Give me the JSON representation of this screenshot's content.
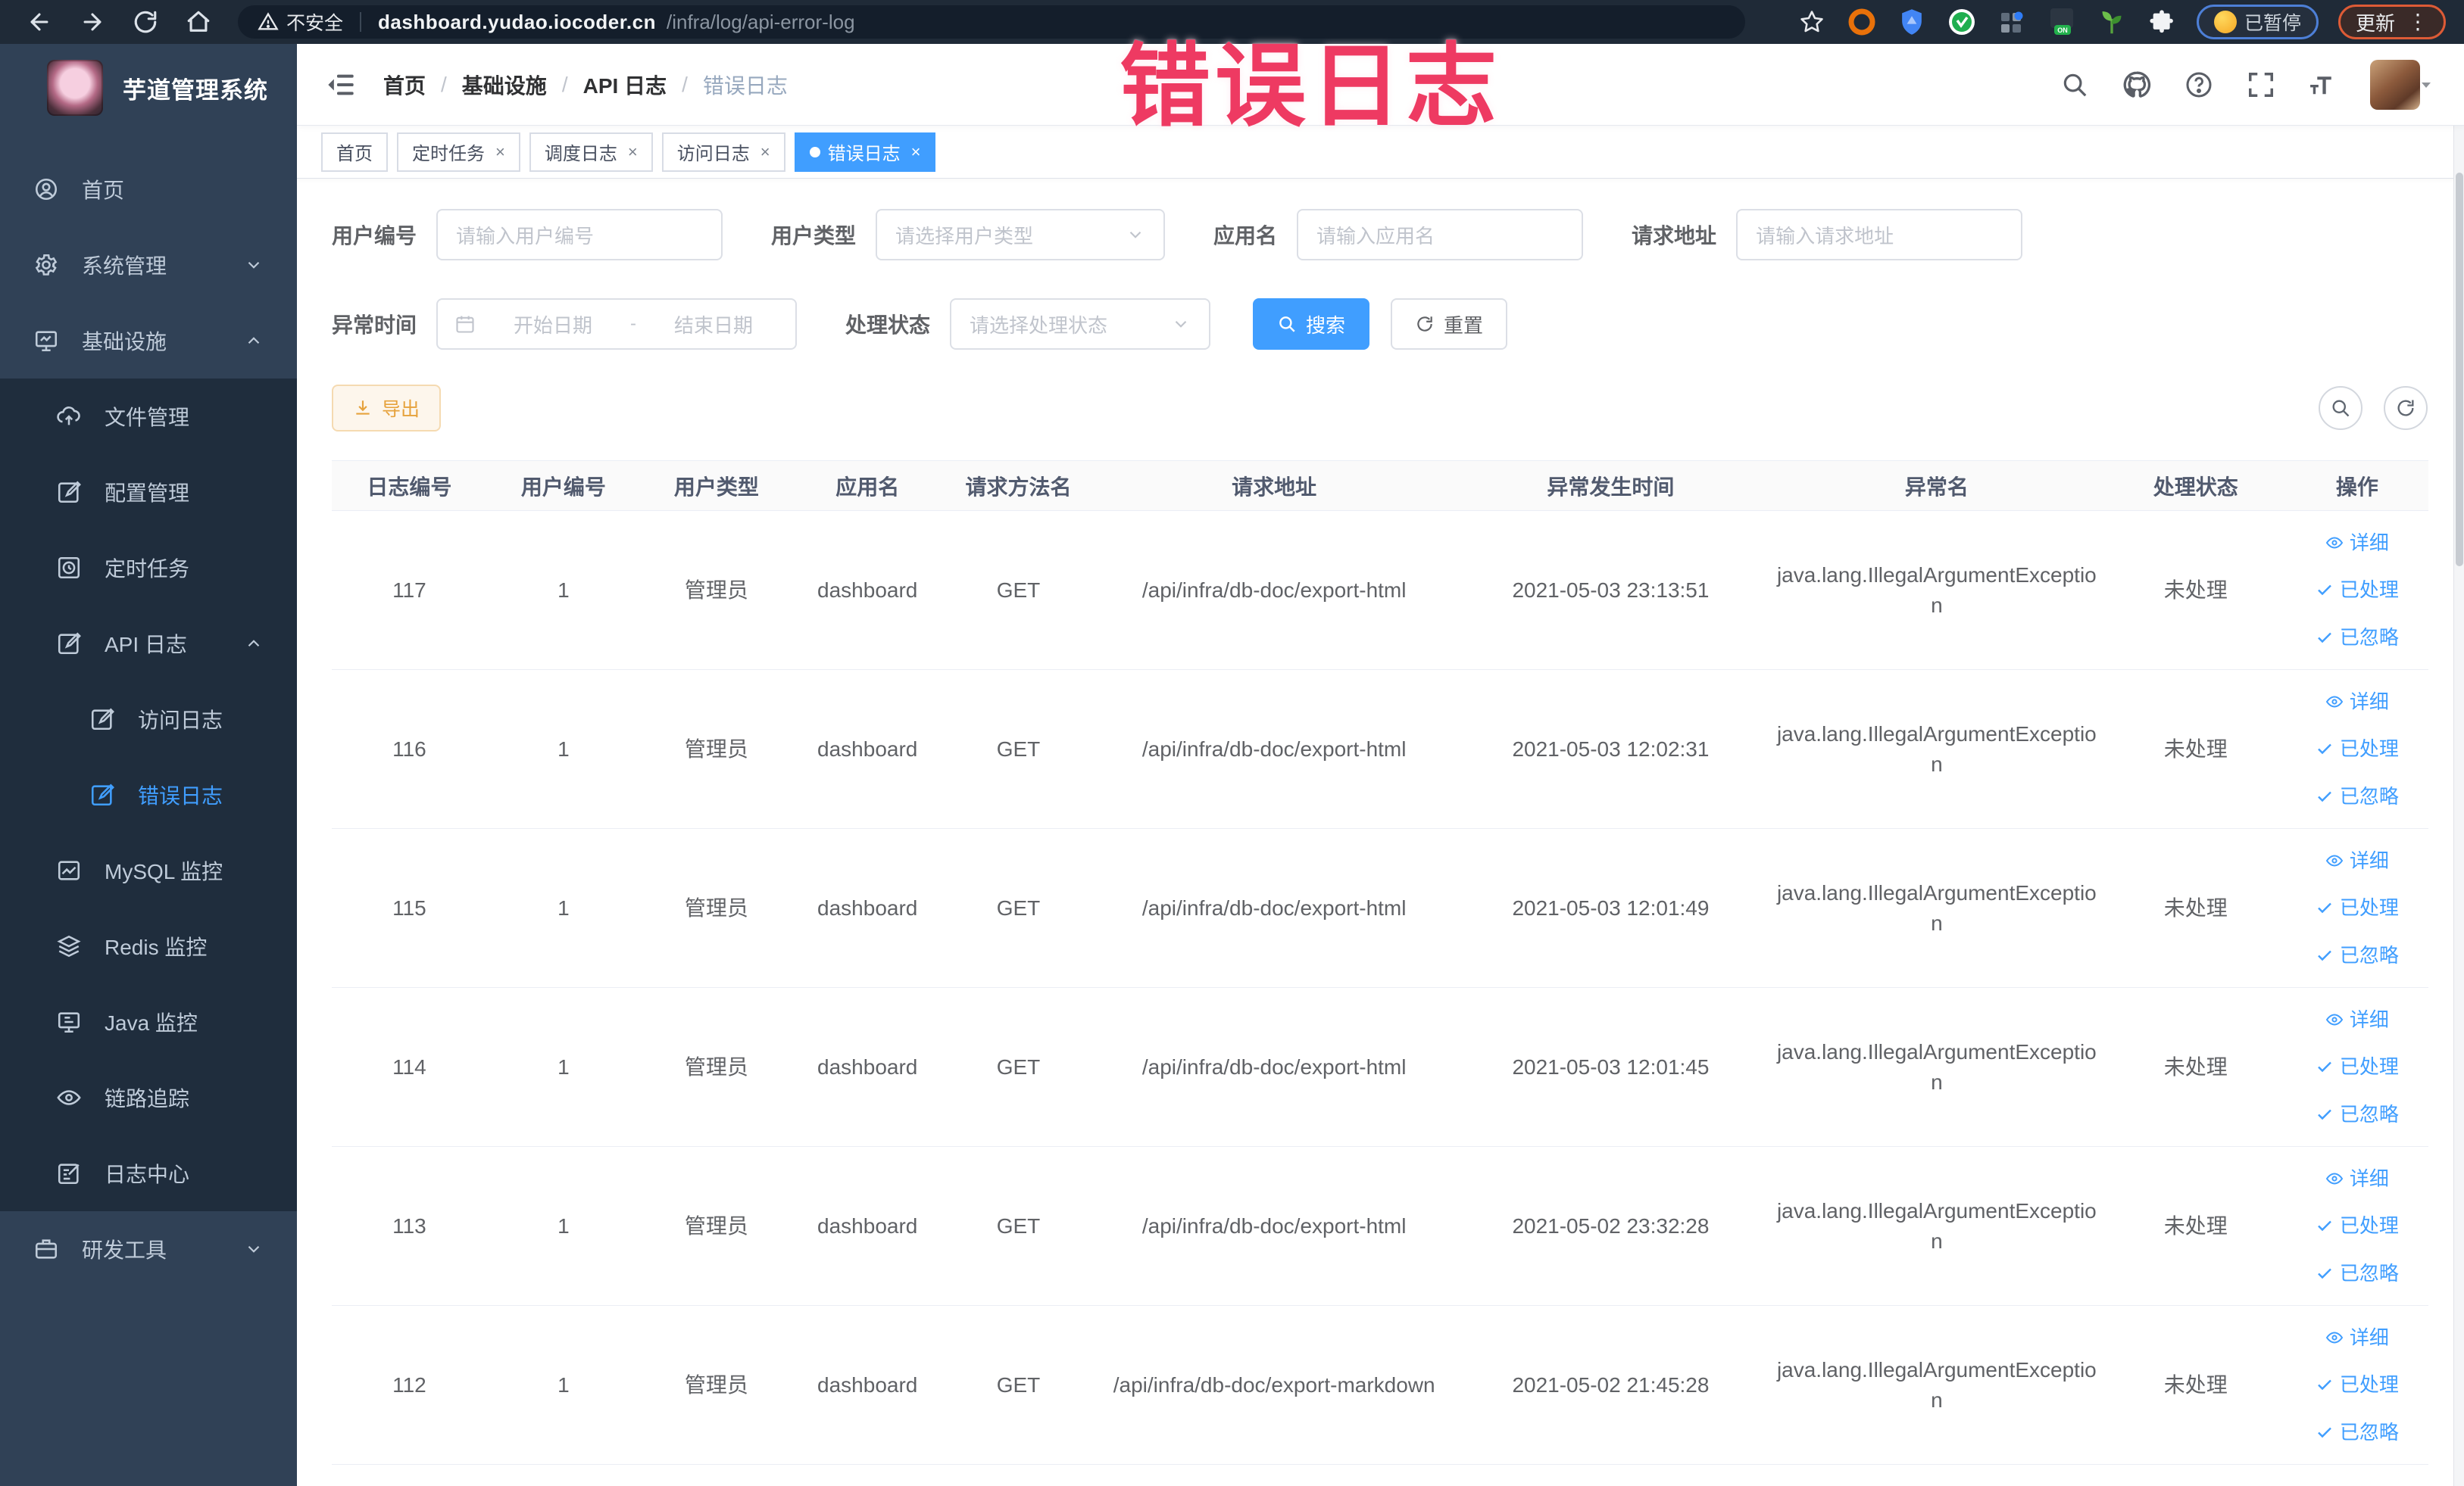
{
  "browser": {
    "security_label": "不安全",
    "url_domain": "dashboard.yudao.iocoder.cn",
    "url_path": "/infra/log/api-error-log",
    "paused_label": "已暂停",
    "update_label": "更新",
    "menu_dots": "⋮"
  },
  "annotation": {
    "text": "错误日志"
  },
  "sidebar": {
    "title": "芋道管理系统",
    "items": {
      "home": "首页",
      "system": "系统管理",
      "infra": "基础设施",
      "file": "文件管理",
      "config": "配置管理",
      "job": "定时任务",
      "api_log": "API 日志",
      "access_log": "访问日志",
      "error_log": "错误日志",
      "mysql": "MySQL 监控",
      "redis": "Redis 监控",
      "java": "Java 监控",
      "trace": "链路追踪",
      "log_center": "日志中心",
      "dev_tool": "研发工具"
    }
  },
  "header": {
    "breadcrumb": [
      "首页",
      "基础设施",
      "API 日志",
      "错误日志"
    ],
    "separator": "/"
  },
  "tabs": [
    {
      "label": "首页"
    },
    {
      "label": "定时任务"
    },
    {
      "label": "调度日志"
    },
    {
      "label": "访问日志"
    },
    {
      "label": "错误日志"
    }
  ],
  "close_glyph": "×",
  "filters": {
    "user_id": {
      "label": "用户编号",
      "placeholder": "请输入用户编号"
    },
    "user_type": {
      "label": "用户类型",
      "placeholder": "请选择用户类型"
    },
    "app_name": {
      "label": "应用名",
      "placeholder": "请输入应用名"
    },
    "req_url": {
      "label": "请求地址",
      "placeholder": "请输入请求地址"
    },
    "ex_time": {
      "label": "异常时间",
      "start_placeholder": "开始日期",
      "range_separator": "-",
      "end_placeholder": "结束日期"
    },
    "status": {
      "label": "处理状态",
      "placeholder": "请选择处理状态"
    },
    "search_label": "搜索",
    "reset_label": "重置"
  },
  "toolbar": {
    "export_label": "导出"
  },
  "table": {
    "headers": [
      "日志编号",
      "用户编号",
      "用户类型",
      "应用名",
      "请求方法名",
      "请求地址",
      "异常发生时间",
      "异常名",
      "处理状态",
      "操作"
    ],
    "actions": {
      "detail": "详细",
      "processed": "已处理",
      "ignored": "已忽略"
    },
    "rows": [
      {
        "id": "117",
        "user_id": "1",
        "user_type": "管理员",
        "app": "dashboard",
        "method": "GET",
        "url": "/api/infra/db-doc/export-html",
        "time": "2021-05-03 23:13:51",
        "exception": "java.lang.IllegalArgumentException",
        "status": "未处理"
      },
      {
        "id": "116",
        "user_id": "1",
        "user_type": "管理员",
        "app": "dashboard",
        "method": "GET",
        "url": "/api/infra/db-doc/export-html",
        "time": "2021-05-03 12:02:31",
        "exception": "java.lang.IllegalArgumentException",
        "status": "未处理"
      },
      {
        "id": "115",
        "user_id": "1",
        "user_type": "管理员",
        "app": "dashboard",
        "method": "GET",
        "url": "/api/infra/db-doc/export-html",
        "time": "2021-05-03 12:01:49",
        "exception": "java.lang.IllegalArgumentException",
        "status": "未处理"
      },
      {
        "id": "114",
        "user_id": "1",
        "user_type": "管理员",
        "app": "dashboard",
        "method": "GET",
        "url": "/api/infra/db-doc/export-html",
        "time": "2021-05-03 12:01:45",
        "exception": "java.lang.IllegalArgumentException",
        "status": "未处理"
      },
      {
        "id": "113",
        "user_id": "1",
        "user_type": "管理员",
        "app": "dashboard",
        "method": "GET",
        "url": "/api/infra/db-doc/export-html",
        "time": "2021-05-02 23:32:28",
        "exception": "java.lang.IllegalArgumentException",
        "status": "未处理"
      },
      {
        "id": "112",
        "user_id": "1",
        "user_type": "管理员",
        "app": "dashboard",
        "method": "GET",
        "url": "/api/infra/db-doc/export-markdown",
        "time": "2021-05-02 21:45:28",
        "exception": "java.lang.IllegalArgumentException",
        "status": "未处理"
      }
    ]
  },
  "colors": {
    "primary": "#409eff",
    "warning": "#e6a23c",
    "annotation_pink": "#ee3a62"
  }
}
